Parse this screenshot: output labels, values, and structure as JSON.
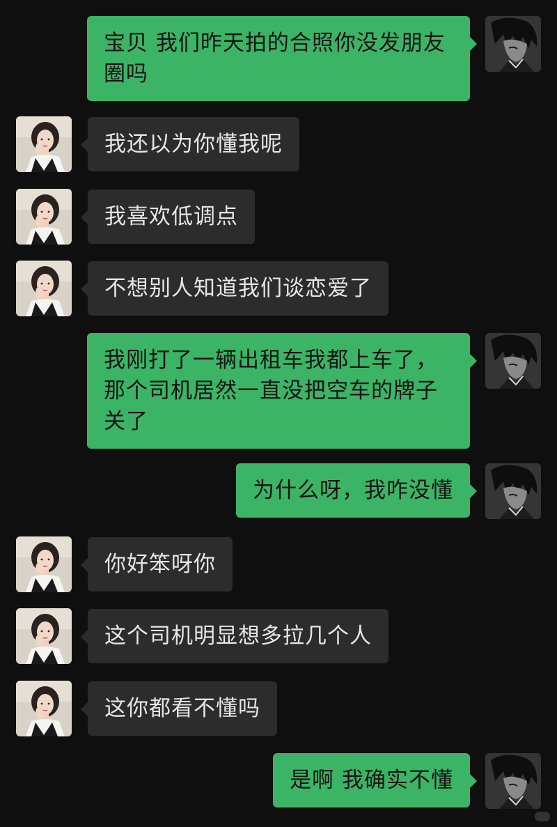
{
  "chat": {
    "messages": [
      {
        "sender": "self",
        "text": "宝贝 我们昨天拍的合照你没发朋友圈吗"
      },
      {
        "sender": "other",
        "text": "我还以为你懂我呢"
      },
      {
        "sender": "other",
        "text": "我喜欢低调点"
      },
      {
        "sender": "other",
        "text": "不想别人知道我们谈恋爱了"
      },
      {
        "sender": "self",
        "text": "我刚打了一辆出租车我都上车了，那个司机居然一直没把空车的牌子关了"
      },
      {
        "sender": "self",
        "text": "为什么呀，我咋没懂"
      },
      {
        "sender": "other",
        "text": "你好笨呀你"
      },
      {
        "sender": "other",
        "text": "这个司机明显想多拉几个人"
      },
      {
        "sender": "other",
        "text": "这你都看不懂吗"
      },
      {
        "sender": "self",
        "text": "是啊 我确实不懂"
      }
    ]
  },
  "colors": {
    "background": "#0f0f0f",
    "sent_bubble": "#3bb466",
    "received_bubble": "#2c2c2c",
    "received_text": "#e6e6e6",
    "sent_text": "#141414"
  },
  "icons": {
    "self_avatar": "anime-boy-avatar-icon",
    "other_avatar": "girl-photo-avatar-icon"
  }
}
